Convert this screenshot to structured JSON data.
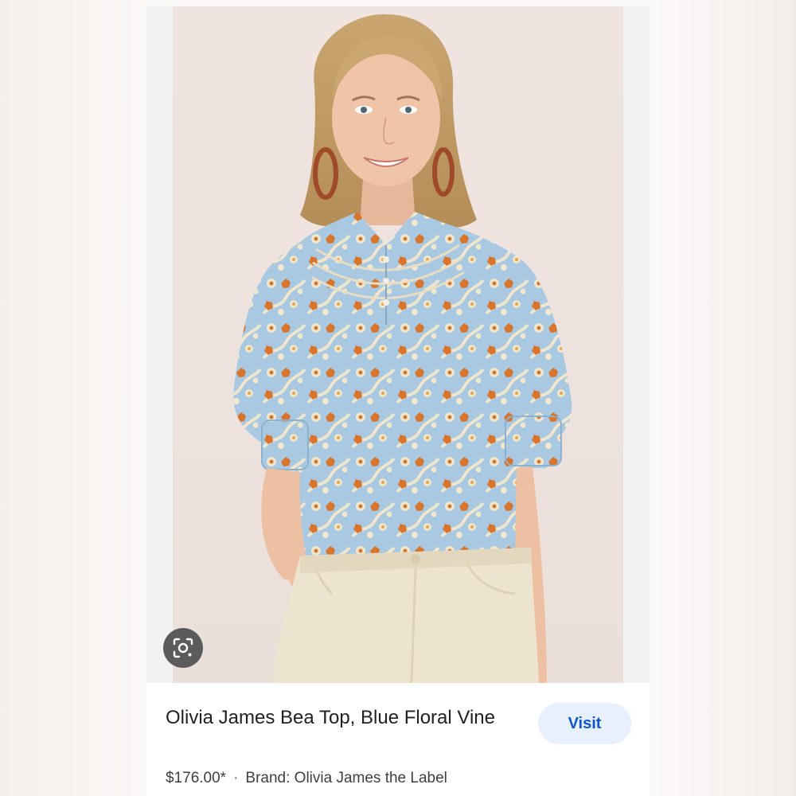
{
  "result_card": {
    "title": "Olivia James Bea Top, Blue Floral Vine",
    "visit_label": "Visit",
    "price": "$176.00*",
    "separator": "·",
    "brand": "Brand: Olivia James the Label",
    "lens_icon": "camera-lens-search-icon"
  },
  "colors": {
    "visit_bg": "#e8f0fe",
    "visit_text": "#0b57d0",
    "lens_bg": "#5b5b5d",
    "photo_bg": "#eee3de",
    "blouse_blue": "#a9c9e2",
    "flower_orange": "#d9742c",
    "pants_cream": "#ede4cf"
  }
}
